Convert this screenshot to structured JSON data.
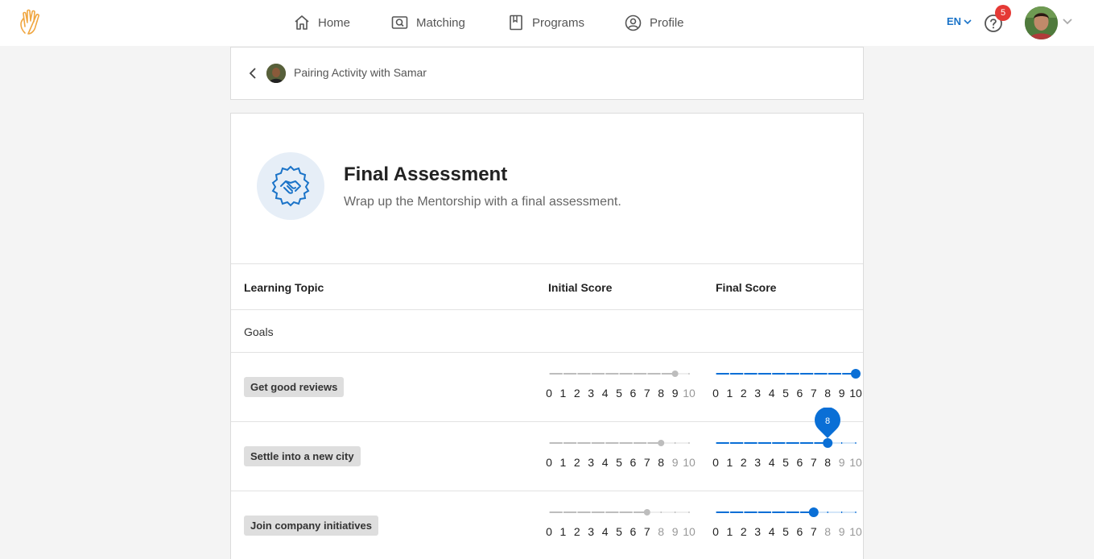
{
  "nav": {
    "items": [
      {
        "label": "Home",
        "icon": "home-icon"
      },
      {
        "label": "Matching",
        "icon": "matching-icon"
      },
      {
        "label": "Programs",
        "icon": "book-icon"
      },
      {
        "label": "Profile",
        "icon": "profile-icon"
      }
    ],
    "language": "EN",
    "help_badge": "5"
  },
  "breadcrumb": {
    "title": "Pairing Activity with Samar"
  },
  "assessment": {
    "title": "Final Assessment",
    "subtitle": "Wrap up the Mentorship with a final assessment."
  },
  "table": {
    "headers": {
      "topic": "Learning Topic",
      "initial": "Initial Score",
      "final": "Final Score"
    },
    "section": "Goals",
    "rows": [
      {
        "topic": "Get good reviews",
        "initial": 9,
        "final": 10
      },
      {
        "topic": "Settle into a new city",
        "initial": 8,
        "final": 8,
        "final_tooltip": "8"
      },
      {
        "topic": "Join company initiatives",
        "initial": 7,
        "final": 7
      }
    ]
  },
  "scale": [
    "0",
    "1",
    "2",
    "3",
    "4",
    "5",
    "6",
    "7",
    "8",
    "9",
    "10"
  ],
  "colors": {
    "accent": "#1a73c8",
    "slider_blue": "#0a6fd6",
    "slider_gray": "#bdbdbd",
    "badge": "#e53935",
    "logo": "#f0a640"
  }
}
